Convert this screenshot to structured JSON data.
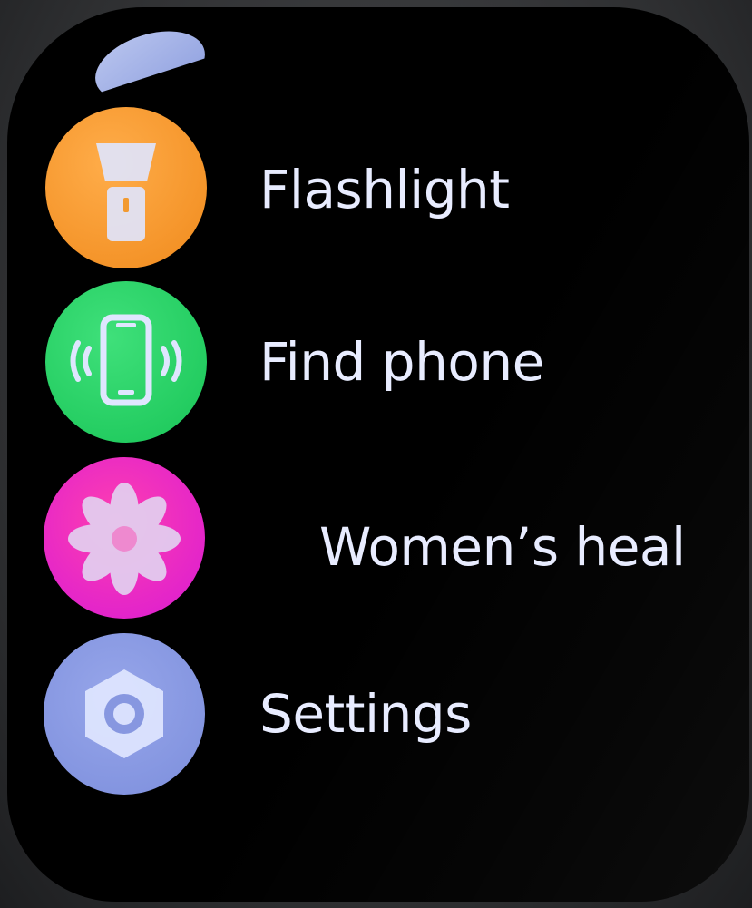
{
  "menu": {
    "items": [
      {
        "label": "Flashlight",
        "icon": "flashlight-icon",
        "color": "#F59A2A"
      },
      {
        "label": "Find phone",
        "icon": "phone-vibrate-icon",
        "color": "#22CF62"
      },
      {
        "label": "Women’s heal",
        "icon": "lotus-icon",
        "color": "#E524C8"
      },
      {
        "label": "Settings",
        "icon": "gear-icon",
        "color": "#8797E0"
      }
    ]
  }
}
